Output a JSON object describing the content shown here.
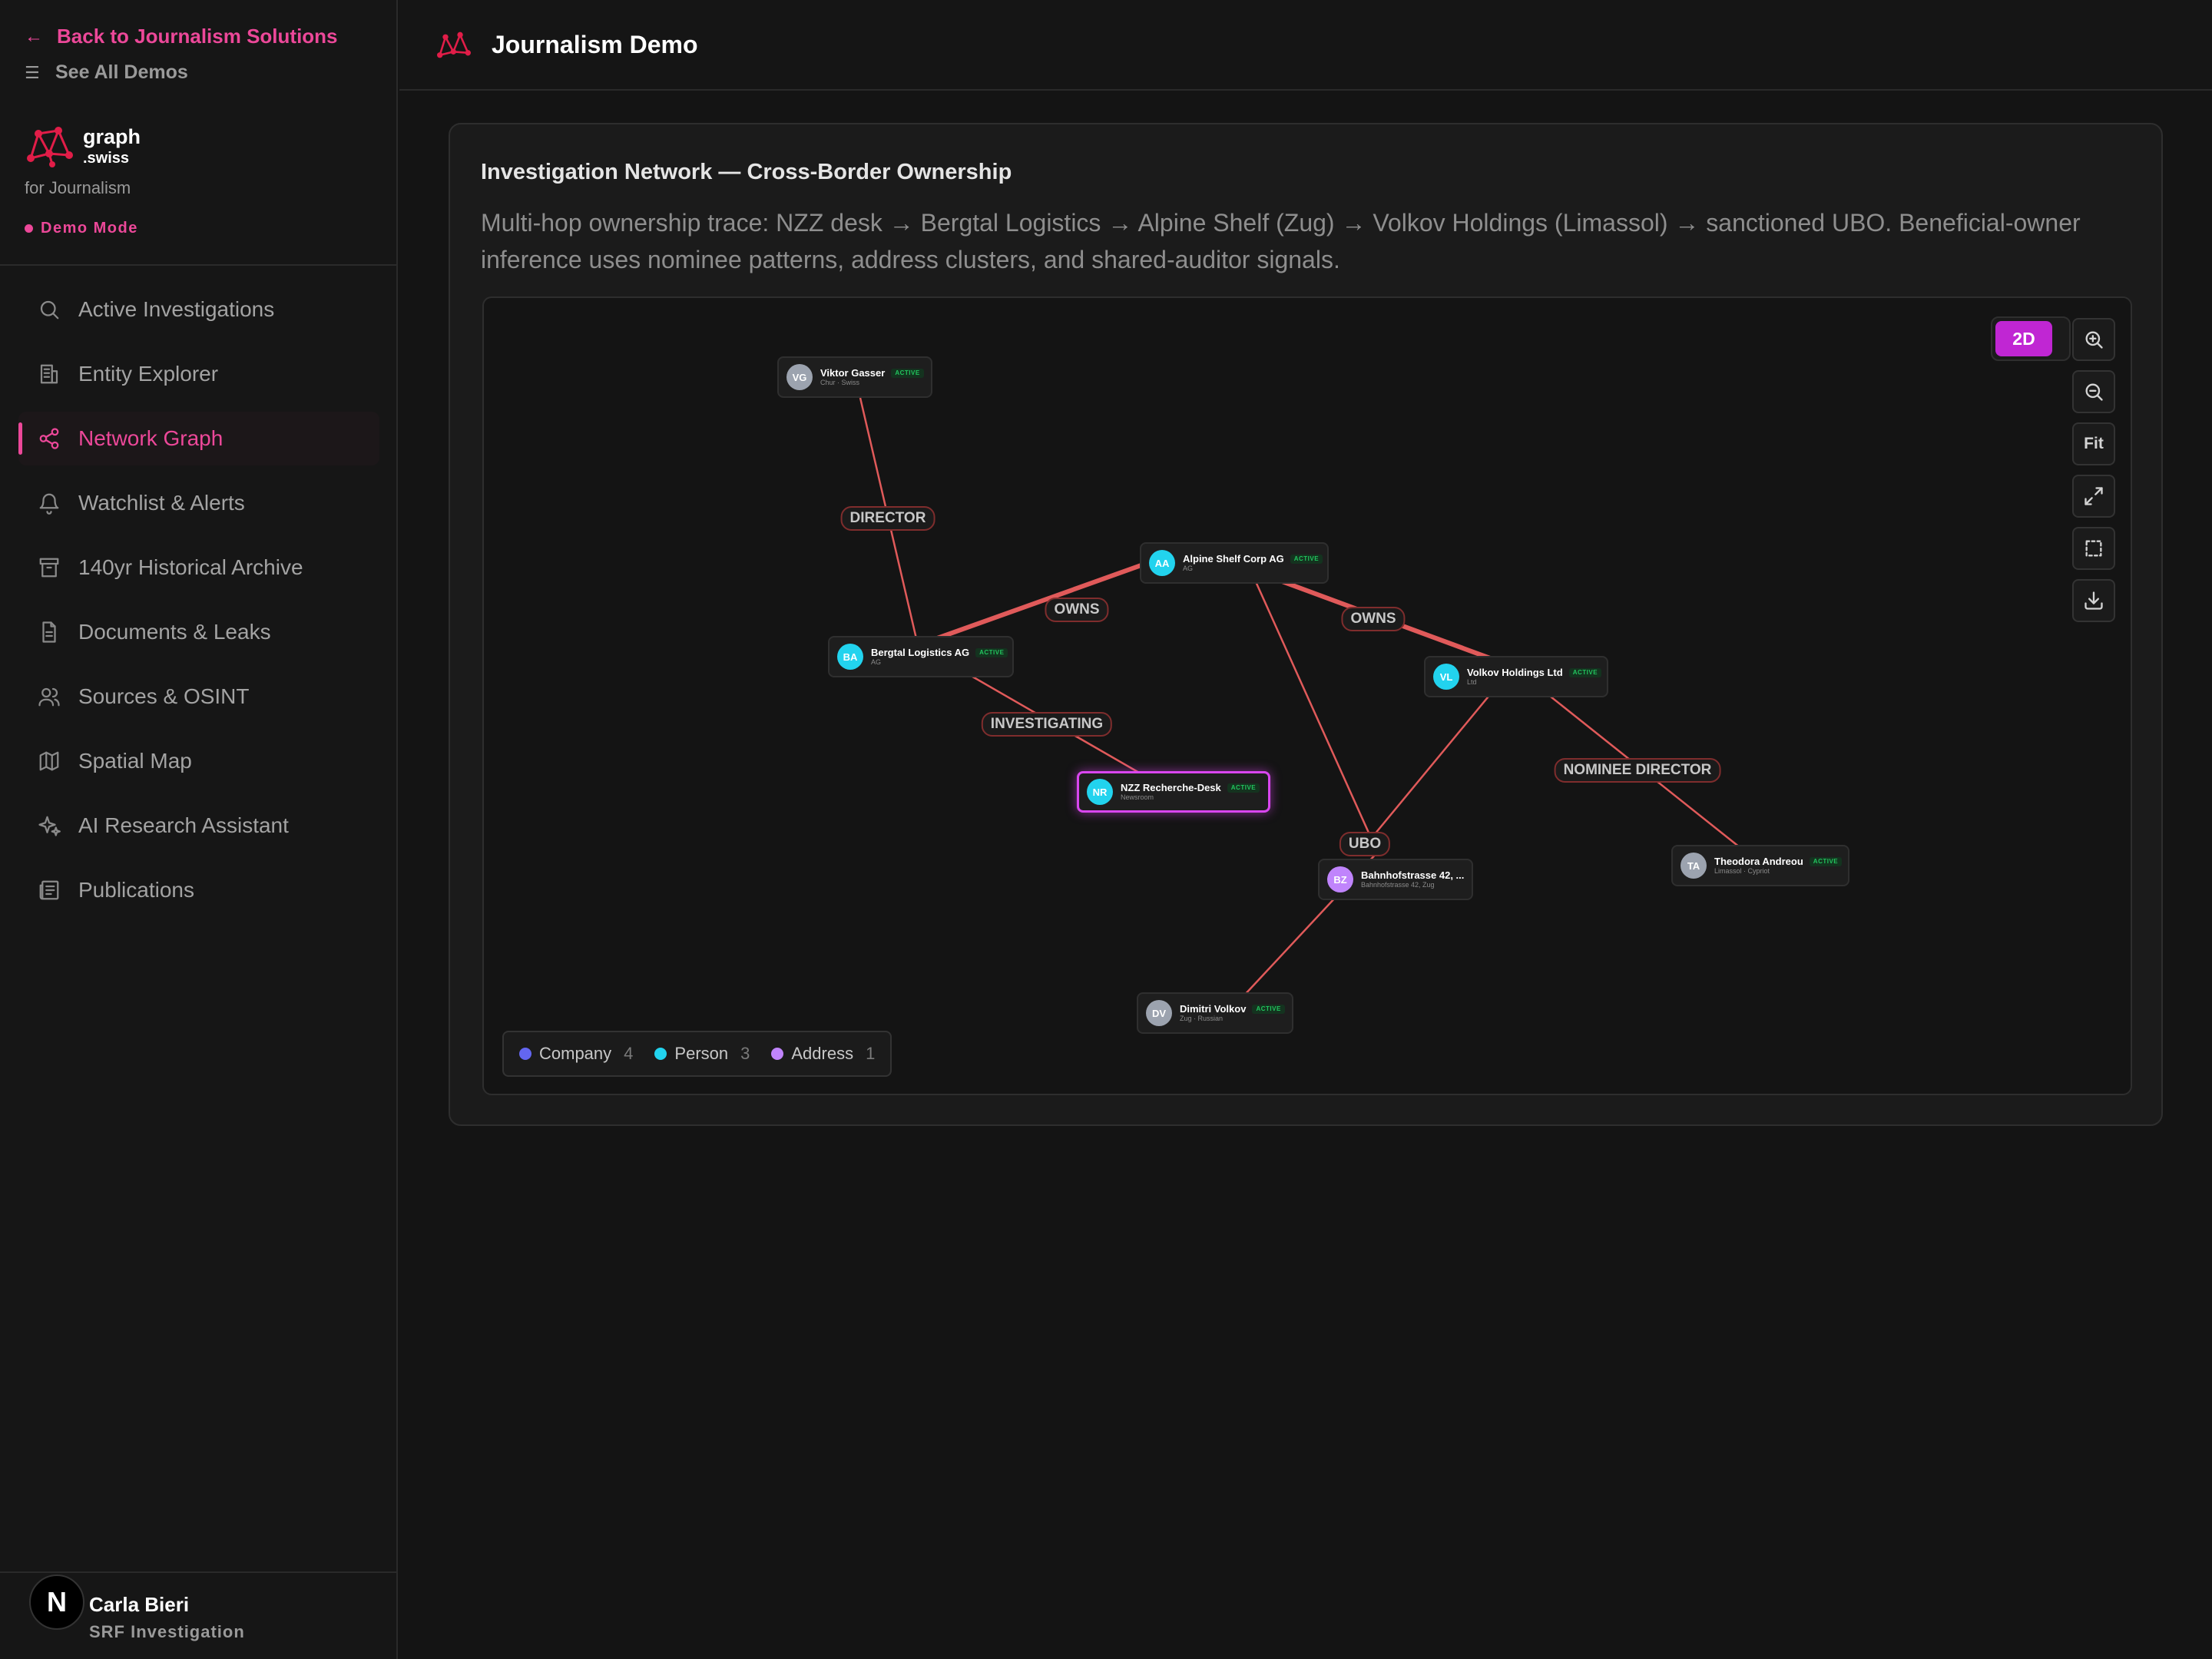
{
  "sidebar": {
    "back_link": "Back to Journalism Solutions",
    "all_demos": "See All Demos",
    "brand_name": "graph",
    "brand_tld": ".swiss",
    "brand_sub": "for Journalism",
    "demo_mode": "Demo Mode",
    "items": [
      {
        "label": "Active Investigations",
        "icon": "search-icon"
      },
      {
        "label": "Entity Explorer",
        "icon": "building-icon"
      },
      {
        "label": "Network Graph",
        "icon": "share-nodes-icon",
        "active": true
      },
      {
        "label": "Watchlist & Alerts",
        "icon": "bell-icon"
      },
      {
        "label": "140yr Historical Archive",
        "icon": "archive-icon"
      },
      {
        "label": "Documents & Leaks",
        "icon": "document-icon"
      },
      {
        "label": "Sources & OSINT",
        "icon": "users-icon"
      },
      {
        "label": "Spatial Map",
        "icon": "map-icon"
      },
      {
        "label": "AI Research Assistant",
        "icon": "sparkles-icon"
      },
      {
        "label": "Publications",
        "icon": "newspaper-icon"
      }
    ],
    "user": {
      "initial": "N",
      "name": "Carla Bieri",
      "role": "SRF Investigation"
    }
  },
  "header": {
    "title": "Journalism Demo"
  },
  "card": {
    "title": "Investigation Network — Cross-Border Ownership",
    "description": "Multi-hop ownership trace: NZZ desk → Bergtal Logistics → Alpine Shelf (Zug) → Volkov Holdings (Limassol) → sanctioned UBO. Beneficial-owner inference uses nominee patterns, address clusters, and shared-auditor signals."
  },
  "graph": {
    "mode": "2D",
    "fit_label": "Fit",
    "badge": "ACTIVE",
    "nodes": [
      {
        "initials": "VG",
        "name": "Viktor Gasser",
        "sub": "Chur · Swiss",
        "color": "#9ca3af"
      },
      {
        "initials": "AA",
        "name": "Alpine Shelf Corp AG",
        "sub": "AG",
        "color": "#22d3ee"
      },
      {
        "initials": "BA",
        "name": "Bergtal Logistics AG",
        "sub": "AG",
        "color": "#22d3ee"
      },
      {
        "initials": "VL",
        "name": "Volkov Holdings Ltd",
        "sub": "Ltd",
        "color": "#22d3ee"
      },
      {
        "initials": "NR",
        "name": "NZZ Recherche-Desk",
        "sub": "Newsroom",
        "color": "#22d3ee",
        "selected": true
      },
      {
        "initials": "BZ",
        "name": "Bahnhofstrasse 42, ...",
        "sub": "Bahnhofstrasse 42, Zug",
        "color": "#c084fc"
      },
      {
        "initials": "TA",
        "name": "Theodora Andreou",
        "sub": "Limassol · Cypriot",
        "color": "#9ca3af"
      },
      {
        "initials": "DV",
        "name": "Dimitri Volkov",
        "sub": "Zug · Russian",
        "color": "#9ca3af"
      }
    ],
    "edge_labels": [
      "DIRECTOR",
      "OWNS",
      "OWNS",
      "INVESTIGATING",
      "NOMINEE DIRECTOR",
      "UBO"
    ],
    "legend": [
      {
        "label": "Company",
        "count": "4",
        "color": "#6366f1"
      },
      {
        "label": "Person",
        "count": "3",
        "color": "#22d3ee"
      },
      {
        "label": "Address",
        "count": "1",
        "color": "#c084fc"
      }
    ]
  }
}
